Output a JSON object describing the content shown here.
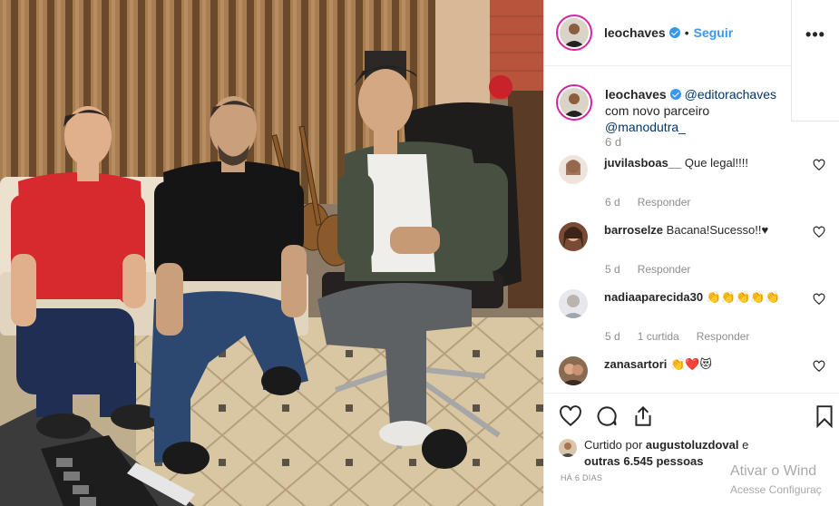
{
  "post": {
    "username": "leochaves",
    "follow_label": "Seguir",
    "dot": "•",
    "more_label": "•••",
    "caption": {
      "username": "leochaves",
      "mention1": "@editorachaves",
      "text_mid": " com novo parceiro ",
      "mention2": "@manodutra_",
      "time": "6 d"
    },
    "comments": [
      {
        "username": "juvilasboas__",
        "text": "Que legal!!!!",
        "time": "6 d",
        "likes": "",
        "reply": "Responder"
      },
      {
        "username": "barroselze",
        "text": "Bacana!Sucesso!!♥",
        "time": "5 d",
        "likes": "",
        "reply": "Responder"
      },
      {
        "username": "nadiaaparecida30",
        "text": "👏👏👏👏👏",
        "time": "5 d",
        "likes": "1 curtida",
        "reply": "Responder"
      },
      {
        "username": "zanasartori",
        "text": "👏❤️😻",
        "time": "",
        "likes": "",
        "reply": ""
      }
    ],
    "liked_by_prefix": "Curtido por ",
    "liked_by_user": "augustoluzdoval",
    "liked_by_and": " e",
    "liked_others": "outras 6.545 pessoas",
    "time_ago": "HÁ 6 DIAS"
  },
  "watermark": {
    "line1": "Ativar o Wind",
    "line2": "Acesse Configuraç"
  },
  "colors": {
    "accent": "#3897f0",
    "mention": "#003569",
    "muted": "#8e8e8e"
  }
}
